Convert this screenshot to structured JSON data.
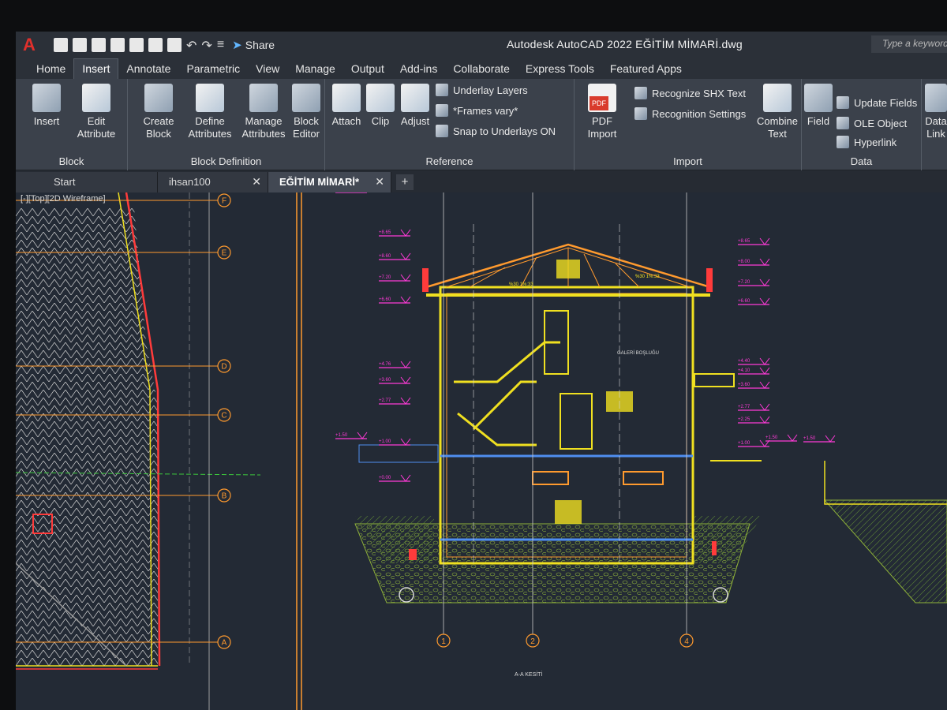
{
  "window": {
    "logo": "A",
    "title": "Autodesk AutoCAD 2022    EĞİTİM MİMARİ.dwg",
    "share_label": "Share",
    "search_placeholder": "Type a keyword or"
  },
  "ribbon_tabs": [
    "Home",
    "Insert",
    "Annotate",
    "Parametric",
    "View",
    "Manage",
    "Output",
    "Add-ins",
    "Collaborate",
    "Express Tools",
    "Featured Apps"
  ],
  "active_tab": "Insert",
  "ribbon": {
    "block": {
      "title": "Block",
      "insert": "Insert",
      "edit": "Edit",
      "attribute": "Attribute"
    },
    "block_definition": {
      "title": "Block Definition",
      "create": "Create",
      "create2": "Block",
      "define": "Define",
      "define2": "Attributes",
      "manage": "Manage",
      "manage2": "Attributes",
      "editor": "Block",
      "editor2": "Editor"
    },
    "reference": {
      "title": "Reference",
      "attach": "Attach",
      "clip": "Clip",
      "adjust": "Adjust",
      "underlay_layers": "Underlay Layers",
      "frames_vary": "*Frames vary*",
      "snap": "Snap to Underlays ON"
    },
    "import": {
      "title": "Import",
      "pdf": "PDF",
      "pdf_import": "Import",
      "recognize": "Recognize SHX Text",
      "recognition": "Recognition Settings",
      "combine": "Combine",
      "combine2": "Text"
    },
    "data": {
      "title": "Data",
      "field": "Field",
      "update": "Update Fields",
      "ole": "OLE Object",
      "hyperlink": "Hyperlink",
      "data_link": "Data",
      "data_link2": "Link"
    }
  },
  "doc_tabs": [
    "Start",
    "ihsan100",
    "EĞİTİM MİMARİ*"
  ],
  "viewport_label": "[-][Top][2D Wireframe]",
  "drawing": {
    "section_label": "A-A KESİTİ",
    "room_label": "GALERİ BOŞLUĞU",
    "grid_left": [
      "F",
      "E",
      "D",
      "C",
      "B",
      "A"
    ],
    "grid_bottom": [
      "1",
      "2",
      "4"
    ],
    "roof_labels": [
      "%30 1%:33",
      "%30 1%:33"
    ],
    "left_levels": [
      "+8.65",
      "+8.60",
      "+7.20",
      "+6.60",
      "+4.76",
      "+3.60",
      "+2.77",
      "+1.00",
      "+0.00"
    ],
    "right_levels": [
      "+8.65",
      "+8.00",
      "+7.20",
      "+6.60",
      "+4.40",
      "+4.10",
      "+3.60",
      "+2.77",
      "+2.25",
      "+1.00"
    ],
    "far_levels": [
      "+1.50",
      "+1.50",
      "+1.50"
    ],
    "colors": {
      "red": "#ff3b3b",
      "yellow": "#f0e020",
      "orange": "#ff9a2e",
      "magenta": "#ff3ad8",
      "green": "#4ccc3c",
      "blue": "#4f8ef0",
      "white": "#d8d8d8"
    }
  }
}
